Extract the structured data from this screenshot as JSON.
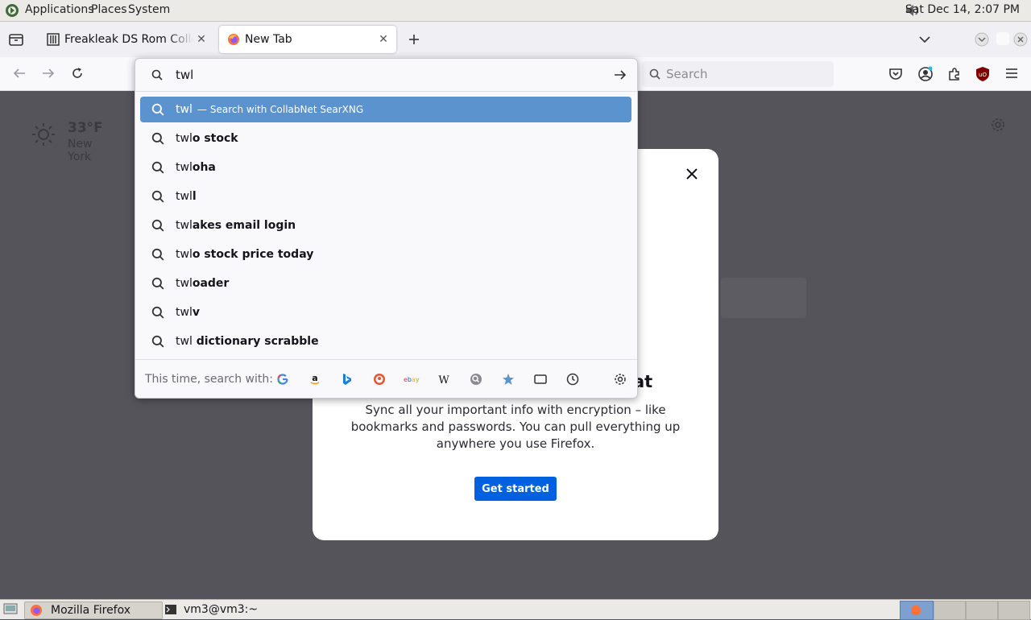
{
  "top_panel": {
    "menus": [
      "Applications",
      "Places",
      "System"
    ],
    "clock": "Sat Dec 14,  2:07 PM"
  },
  "tabs": [
    {
      "title": "Freakleak DS Rom Collection",
      "active": false
    },
    {
      "title": "New Tab",
      "active": true
    }
  ],
  "navbar": {
    "search_placeholder": "Search"
  },
  "url_dropdown": {
    "query": "twl",
    "action_label": "Search with CollabNet SearXNG",
    "action_separator": "—",
    "suggestions": [
      {
        "prefix": "twl",
        "suffix": "o stock"
      },
      {
        "prefix": "twl",
        "suffix": "oha"
      },
      {
        "prefix": "twl",
        "suffix": "l"
      },
      {
        "prefix": "twl",
        "suffix": "akes email login"
      },
      {
        "prefix": "twl",
        "suffix": "o stock price today"
      },
      {
        "prefix": "twl",
        "suffix": "oader"
      },
      {
        "prefix": "twl",
        "suffix": "v"
      },
      {
        "prefix": "twl",
        "suffix": " dictionary scrabble"
      }
    ],
    "one_off_label": "This time, search with:",
    "engines": [
      "google",
      "amazon",
      "bing",
      "duckduckgo",
      "ebay",
      "wikipedia",
      "searxng",
      "bookmarks",
      "tabs",
      "history"
    ]
  },
  "weather": {
    "temperature": "33°F",
    "location": "New York"
  },
  "modal": {
    "heading_tail": "at",
    "body": "Sync all your important info with encryption – like bookmarks and passwords. You can pull everything up anywhere you use Firefox.",
    "button": "Get started"
  },
  "taskbar": {
    "items": [
      "Mozilla Firefox",
      "vm3@vm3:~"
    ]
  },
  "colors": {
    "accent_blue": "#0061e0",
    "selected_row": "#5b93cf",
    "page_bg": "#54545a"
  }
}
